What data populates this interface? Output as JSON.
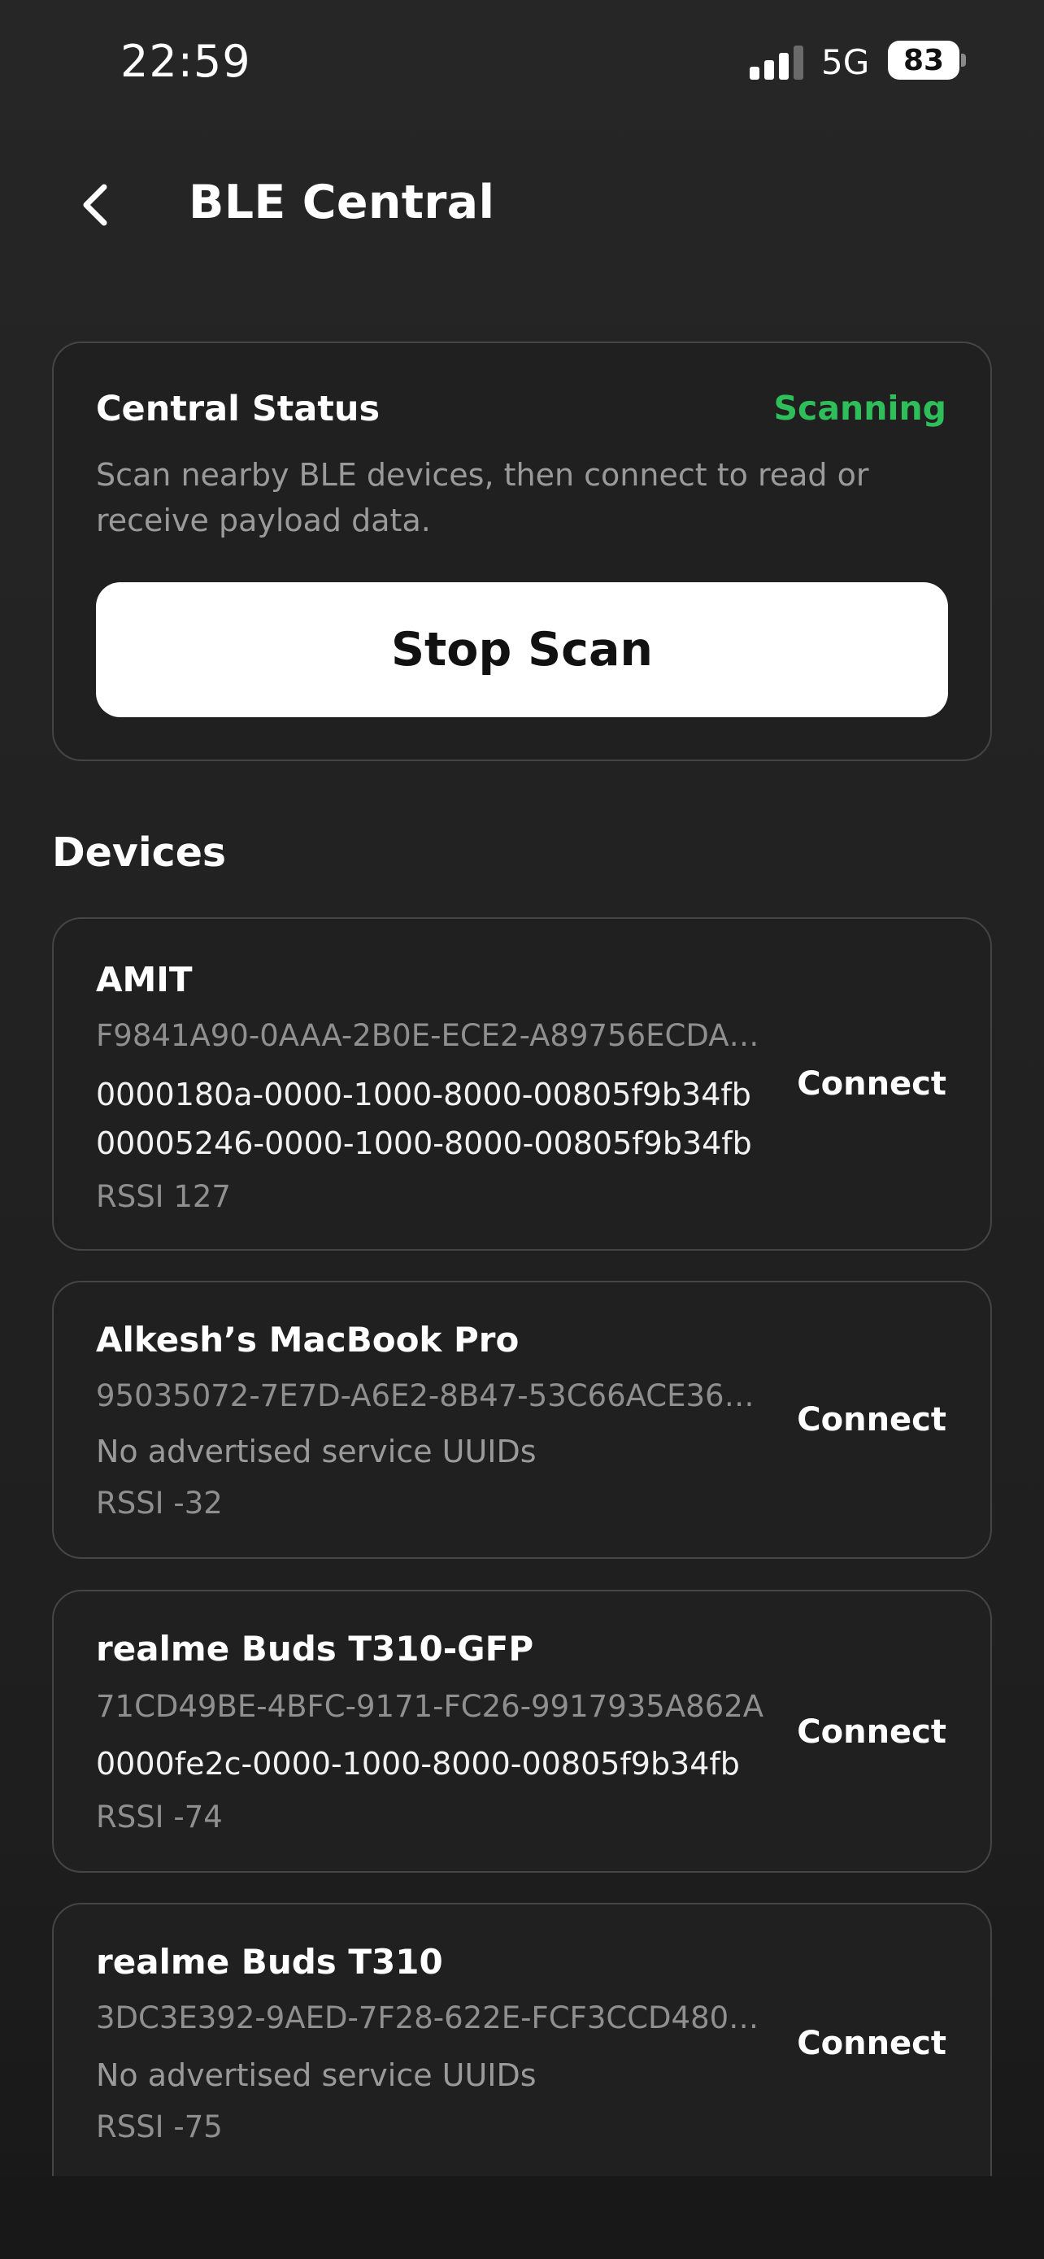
{
  "status_bar": {
    "time": "22:59",
    "network": "5G",
    "battery": "83"
  },
  "header": {
    "title": "BLE Central",
    "back_icon": "chevron-left-icon"
  },
  "central_status": {
    "heading": "Central Status",
    "state": "Scanning",
    "state_color": "#2fbf5a",
    "description": "Scan nearby BLE devices, then connect to read or receive payload data.",
    "button_label": "Stop Scan"
  },
  "devices_section": {
    "title": "Devices",
    "items": [
      {
        "name": "AMIT",
        "id": "F9841A90-0AAA-2B0E-ECE2-A89756ECDA…",
        "services": [
          "0000180a-0000-1000-8000-00805f9b34fb",
          "00005246-0000-1000-8000-00805f9b34fb"
        ],
        "rssi": "RSSI 127",
        "action": "Connect"
      },
      {
        "name": "Alkesh’s MacBook Pro",
        "id": "95035072-7E7D-A6E2-8B47-53C66ACE36…",
        "services_note": "No advertised service UUIDs",
        "rssi": "RSSI -32",
        "action": "Connect"
      },
      {
        "name": "realme Buds T310-GFP",
        "id": "71CD49BE-4BFC-9171-FC26-9917935A862A",
        "services": [
          "0000fe2c-0000-1000-8000-00805f9b34fb"
        ],
        "rssi": "RSSI -74",
        "action": "Connect"
      },
      {
        "name": "realme Buds T310",
        "id": "3DC3E392-9AED-7F28-622E-FCF3CCD480…",
        "services_note": "No advertised service UUIDs",
        "rssi": "RSSI -75",
        "action": "Connect"
      }
    ]
  }
}
